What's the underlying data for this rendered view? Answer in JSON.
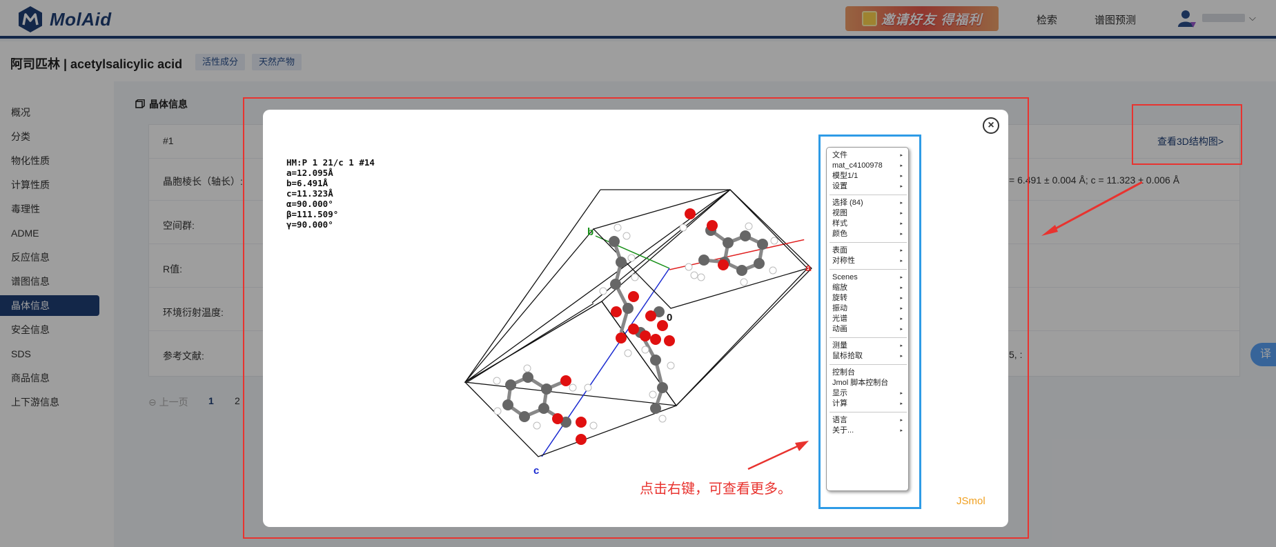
{
  "header": {
    "logo_text": "MolAid",
    "promo_text": "邀请好友 得福利",
    "nav": [
      "检索",
      "谱图预测"
    ]
  },
  "titlebar": {
    "title": "阿司匹林 | acetylsalicylic acid",
    "tags": [
      "活性成分",
      "天然产物"
    ]
  },
  "sidebar": {
    "items": [
      "概况",
      "分类",
      "物化性质",
      "计算性质",
      "毒理性",
      "ADME",
      "反应信息",
      "谱图信息",
      "晶体信息",
      "安全信息",
      "SDS",
      "商品信息",
      "上下游信息"
    ],
    "active": "晶体信息"
  },
  "main": {
    "section_title": "晶体信息",
    "entry_no": "#1",
    "rows": [
      "晶胞棱长（轴长）:",
      "空间群:",
      "R值:",
      "环境衍射温度:",
      "参考文献:"
    ],
    "lattice_tail": "= 6.491 ± 0.004 Å; c = 11.323 ± 0.006 Å",
    "reference_tail": "5, :",
    "view_3d_link": "查看3D结构图>",
    "pager": {
      "prev": "上一页",
      "pages": [
        "1",
        "2"
      ]
    },
    "translate_label": "译"
  },
  "modal": {
    "info_lines": [
      "HM:P 1 21/c 1 #14",
      "a=12.095Å",
      "b=6.491Å",
      "c=11.323Å",
      "α=90.000°",
      "β=111.509°",
      "γ=90.000°"
    ],
    "axis_labels": {
      "a": "a",
      "b": "b",
      "c": "c",
      "origin": "0"
    },
    "close_label": "×",
    "hint": "点击右键，可查看更多。",
    "brand": "JSmol"
  },
  "context_menu": {
    "groups": [
      [
        {
          "label": "文件",
          "sub": true
        },
        {
          "label": "mat_c4100978",
          "sub": true
        },
        {
          "label": "模型1/1",
          "sub": true
        },
        {
          "label": "设置",
          "sub": true
        }
      ],
      [
        {
          "label": "选择 (84)",
          "sub": true
        },
        {
          "label": "视图",
          "sub": true
        },
        {
          "label": "样式",
          "sub": true
        },
        {
          "label": "颜色",
          "sub": true
        }
      ],
      [
        {
          "label": "表面",
          "sub": true
        },
        {
          "label": "对称性",
          "sub": true
        }
      ],
      [
        {
          "label": "Scenes",
          "sub": true
        },
        {
          "label": "缩放",
          "sub": true
        },
        {
          "label": "旋转",
          "sub": true
        },
        {
          "label": "振动",
          "sub": true
        },
        {
          "label": "光谱",
          "sub": true
        },
        {
          "label": "动画",
          "sub": true
        }
      ],
      [
        {
          "label": "测量",
          "sub": true
        },
        {
          "label": "鼠标拾取",
          "sub": true
        }
      ],
      [
        {
          "label": "控制台",
          "sub": false
        },
        {
          "label": "Jmol 脚本控制台",
          "sub": false
        },
        {
          "label": "显示",
          "sub": true
        },
        {
          "label": "计算",
          "sub": true
        }
      ],
      [
        {
          "label": "语言",
          "sub": true
        },
        {
          "label": "关于...",
          "sub": true
        }
      ]
    ]
  },
  "colors": {
    "brand": "#1f3f77",
    "highlight_red": "#e8332f",
    "highlight_blue": "#2e9be6",
    "axis_a": "#e02020",
    "axis_b": "#178f17",
    "axis_c": "#1a2ad0",
    "jsmol_brand": "#f0a020"
  }
}
